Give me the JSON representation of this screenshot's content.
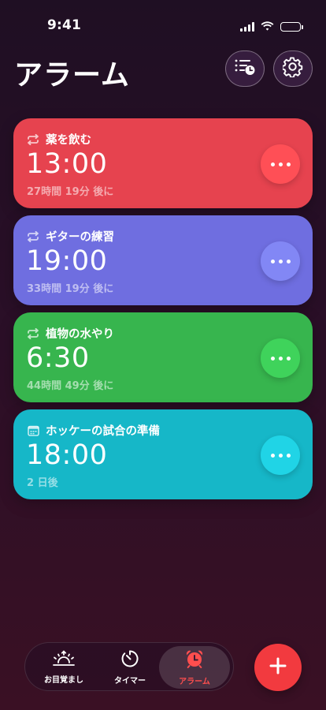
{
  "status_bar": {
    "time": "9:41"
  },
  "header": {
    "title": "アラーム",
    "list_button_icon": "list-clock-icon",
    "settings_button_icon": "gear-icon"
  },
  "alarms": [
    {
      "name": "薬を飲む",
      "time": "13:00",
      "until": "27時間 19分 後に",
      "icon": "repeat-icon",
      "color": "#e6434f",
      "button_color": "#ff4f56"
    },
    {
      "name": "ギターの練習",
      "time": "19:00",
      "until": "33時間 19分 後に",
      "icon": "repeat-icon",
      "color": "#6f6ee0",
      "button_color": "#8287f5"
    },
    {
      "name": "植物の水やり",
      "time": "6:30",
      "until": "44時間 49分 後に",
      "icon": "repeat-icon",
      "color": "#37b54e",
      "button_color": "#3fd35b"
    },
    {
      "name": "ホッケーの試合の準備",
      "time": "18:00",
      "until": "2 日後",
      "icon": "calendar-icon",
      "color": "#16b7c8",
      "button_color": "#20d4e6"
    }
  ],
  "tab_bar": {
    "tabs": [
      {
        "label": "お目覚まし",
        "icon": "sunrise-icon",
        "active": false
      },
      {
        "label": "タイマー",
        "icon": "timer-icon",
        "active": false
      },
      {
        "label": "アラーム",
        "icon": "alarm-clock-icon",
        "active": true
      }
    ],
    "add_button_icon": "plus-icon"
  },
  "colors": {
    "accent": "#f23a3f",
    "active_tab_label": "#ff4e4e"
  }
}
